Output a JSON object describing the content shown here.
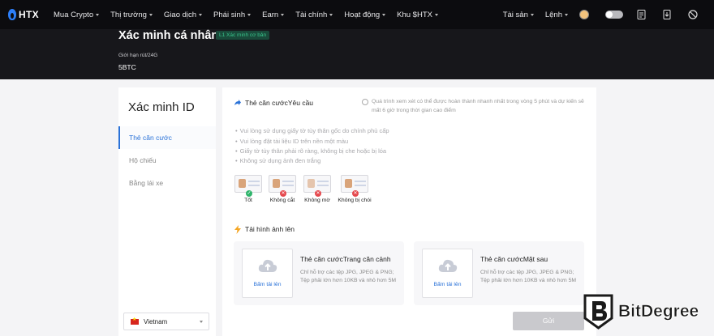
{
  "nav": {
    "logo": "HTX",
    "items": [
      {
        "label": "Mua Crypto",
        "caret": true
      },
      {
        "label": "Thị trường",
        "caret": true
      },
      {
        "label": "Giao dịch",
        "caret": true
      },
      {
        "label": "Phái sinh",
        "caret": true
      },
      {
        "label": "Earn",
        "caret": true
      },
      {
        "label": "Tài chính",
        "caret": true
      },
      {
        "label": "Hoạt động",
        "caret": true
      },
      {
        "label": "Khu $HTX",
        "caret": true
      }
    ],
    "right_items": [
      {
        "label": "Tài sản"
      },
      {
        "label": "Lệnh"
      }
    ],
    "icons": [
      "avatar-icon",
      "toggle-icon",
      "document-icon",
      "download-icon",
      "language-icon"
    ]
  },
  "header": {
    "title": "Xác minh cá nhân",
    "badge": "L1 Xác minh cơ bản",
    "limit_label": "Giới hạn rút/24G",
    "limit_value": "5BTC"
  },
  "sidebar": {
    "title": "Xác minh ID",
    "items": [
      {
        "label": "Thẻ căn cước",
        "active": true
      },
      {
        "label": "Hộ chiếu",
        "active": false
      },
      {
        "label": "Bằng lái xe",
        "active": false
      }
    ],
    "country": "Vietnam"
  },
  "main": {
    "section1_title": "Thẻ căn cướcYêu cầu",
    "notice": "Quá trình xem xét có thể được hoàn thành nhanh nhất trong vòng 5 phút và dự kiến sẽ mất 6 giờ trong thời gian cao điểm",
    "rules": [
      "Vui lòng sử dụng giấy tờ tùy thân gốc do chính phủ cấp",
      "Vui lòng đặt tài liệu ID trên nền một màu",
      "Giấy tờ tùy thân phải rõ ràng, không bị che hoặc bị lóa",
      "Không sử dụng ảnh đen trắng"
    ],
    "samples": [
      {
        "label": "Tốt",
        "status": "ok"
      },
      {
        "label": "Không cắt",
        "status": "bad"
      },
      {
        "label": "Không mờ",
        "status": "bad"
      },
      {
        "label": "Không bị chói",
        "status": "bad"
      }
    ],
    "section2_title": "Tải hình ảnh lên",
    "uploads": [
      {
        "title": "Thẻ căn cướcTrang căn cảnh",
        "button": "Bấm tải lên",
        "desc": "Chỉ hỗ trợ các tệp JPG, JPEG & PNG; Tệp phải lớn hơn 10KB và nhỏ hơn 5M"
      },
      {
        "title": "Thẻ căn cướcMặt sau",
        "button": "Bấm tải lên",
        "desc": "Chỉ hỗ trợ các tệp JPG, JPEG & PNG; Tệp phải lớn hơn 10KB và nhỏ hơn 5M"
      }
    ],
    "submit": "Gửi"
  },
  "watermark": {
    "text": "BitDegree"
  },
  "colors": {
    "accent": "#2a72d8",
    "nav_bg": "#0c0c0f",
    "band_bg": "#17171b",
    "success": "#2fb46b",
    "danger": "#e5484d",
    "badge_text": "#39c28a"
  }
}
